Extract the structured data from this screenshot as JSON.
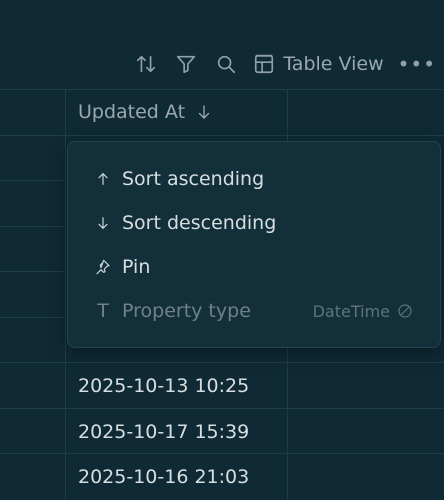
{
  "toolbar": {
    "view_label": "Table View",
    "more_label": "•••"
  },
  "column": {
    "header_label": "Updated At"
  },
  "menu": {
    "items": [
      {
        "label": "Sort ascending",
        "icon": "arrow-up-icon"
      },
      {
        "label": "Sort descending",
        "icon": "arrow-down-icon"
      },
      {
        "label": "Pin",
        "icon": "pin-icon"
      },
      {
        "label": "Property type",
        "icon": "text-type-icon",
        "type_letter": "T",
        "value": "DateTime"
      }
    ]
  },
  "rows": [
    {
      "updated_at": "2025-10-13 10:25"
    },
    {
      "updated_at": "2025-10-17 15:39"
    },
    {
      "updated_at": "2025-10-16 21:03"
    }
  ]
}
